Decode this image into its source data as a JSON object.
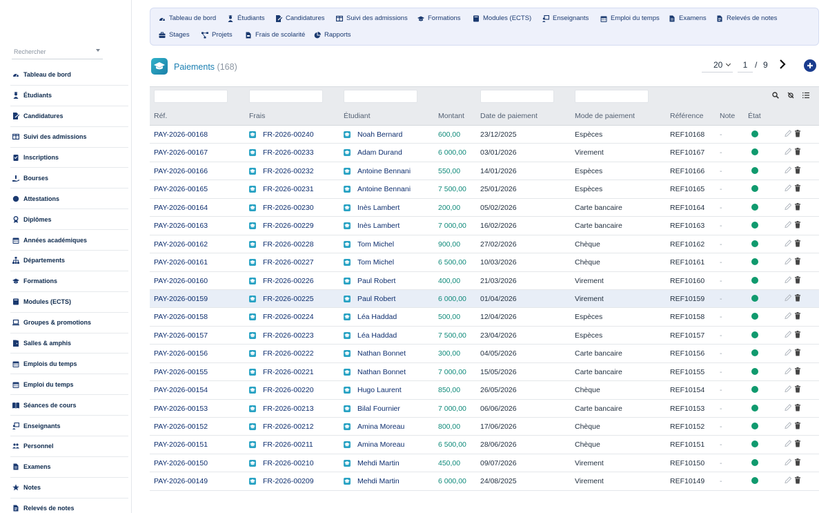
{
  "search": {
    "placeholder": "Rechercher"
  },
  "sidebar": {
    "items": [
      {
        "label": "Tableau de bord",
        "icon": "gauge-icon"
      },
      {
        "label": "Étudiants",
        "icon": "user-graduate-icon"
      },
      {
        "label": "Candidatures",
        "icon": "file-signature-icon"
      },
      {
        "label": "Suivi des admissions",
        "icon": "columns-icon"
      },
      {
        "label": "Inscriptions",
        "icon": "clipboard-icon"
      },
      {
        "label": "Bourses",
        "icon": "hand-holding-icon"
      },
      {
        "label": "Attestations",
        "icon": "certificate-icon"
      },
      {
        "label": "Diplômes",
        "icon": "award-icon"
      },
      {
        "label": "Années académiques",
        "icon": "calendar-icon"
      },
      {
        "label": "Départements",
        "icon": "sitemap-icon"
      },
      {
        "label": "Formations",
        "icon": "graduation-cap-icon"
      },
      {
        "label": "Modules (ECTS)",
        "icon": "book-icon"
      },
      {
        "label": "Groupes & promotions",
        "icon": "laptop-icon"
      },
      {
        "label": "Salles & amphis",
        "icon": "door-icon"
      },
      {
        "label": "Emplois du temps",
        "icon": "calendar-icon"
      },
      {
        "label": "Emploi du temps",
        "icon": "calendar-icon"
      },
      {
        "label": "Séances de cours",
        "icon": "book-open-icon"
      },
      {
        "label": "Enseignants",
        "icon": "chalkboard-teacher-icon"
      },
      {
        "label": "Personnel",
        "icon": "users-icon"
      },
      {
        "label": "Examens",
        "icon": "file-icon"
      },
      {
        "label": "Notes",
        "icon": "star-icon"
      },
      {
        "label": "Relevés de notes",
        "icon": "file-alt-icon"
      }
    ]
  },
  "topnav": {
    "row1": [
      {
        "label": "Tableau de bord",
        "icon": "gauge-icon"
      },
      {
        "label": "Étudiants",
        "icon": "user-graduate-icon"
      },
      {
        "label": "Candidatures",
        "icon": "file-signature-icon"
      },
      {
        "label": "Suivi des admissions",
        "icon": "columns-icon"
      },
      {
        "label": "Formations",
        "icon": "graduation-cap-icon"
      },
      {
        "label": "Modules (ECTS)",
        "icon": "book-icon"
      },
      {
        "label": "Enseignants",
        "icon": "chalkboard-teacher-icon"
      },
      {
        "label": "Emploi du temps",
        "icon": "calendar-icon"
      },
      {
        "label": "Examens",
        "icon": "file-icon"
      },
      {
        "label": "Relevés de notes",
        "icon": "file-alt-icon"
      }
    ],
    "row2": [
      {
        "label": "Stages",
        "icon": "briefcase-icon"
      },
      {
        "label": "Projets",
        "icon": "project-diagram-icon"
      },
      {
        "label": "Frais de scolarité",
        "icon": "file-invoice-icon"
      },
      {
        "label": "Rapports",
        "icon": "chart-pie-icon"
      }
    ]
  },
  "header": {
    "title": "Paiements",
    "count": "(168)",
    "per_page": "20",
    "page": "1",
    "page_sep": "/",
    "total_pages": "9"
  },
  "table": {
    "columns": [
      "Réf.",
      "Frais",
      "Étudiant",
      "Montant",
      "Date de paiement",
      "Mode de paiement",
      "Référence",
      "Note",
      "État"
    ],
    "rows": [
      {
        "ref": "PAY-2026-00168",
        "frais": "FR-2026-00240",
        "etudiant": "Noah Bernard",
        "montant": "600,00",
        "date": "23/12/2025",
        "mode": "Espèces",
        "reference": "REF10168",
        "note": "-"
      },
      {
        "ref": "PAY-2026-00167",
        "frais": "FR-2026-00233",
        "etudiant": "Adam Durand",
        "montant": "6 000,00",
        "date": "03/01/2026",
        "mode": "Virement",
        "reference": "REF10167",
        "note": "-"
      },
      {
        "ref": "PAY-2026-00166",
        "frais": "FR-2026-00232",
        "etudiant": "Antoine Bennani",
        "montant": "550,00",
        "date": "14/01/2026",
        "mode": "Espèces",
        "reference": "REF10166",
        "note": "-"
      },
      {
        "ref": "PAY-2026-00165",
        "frais": "FR-2026-00231",
        "etudiant": "Antoine Bennani",
        "montant": "7 500,00",
        "date": "25/01/2026",
        "mode": "Espèces",
        "reference": "REF10165",
        "note": "-"
      },
      {
        "ref": "PAY-2026-00164",
        "frais": "FR-2026-00230",
        "etudiant": "Inès Lambert",
        "montant": "200,00",
        "date": "05/02/2026",
        "mode": "Carte bancaire",
        "reference": "REF10164",
        "note": "-"
      },
      {
        "ref": "PAY-2026-00163",
        "frais": "FR-2026-00229",
        "etudiant": "Inès Lambert",
        "montant": "7 000,00",
        "date": "16/02/2026",
        "mode": "Carte bancaire",
        "reference": "REF10163",
        "note": "-"
      },
      {
        "ref": "PAY-2026-00162",
        "frais": "FR-2026-00228",
        "etudiant": "Tom Michel",
        "montant": "900,00",
        "date": "27/02/2026",
        "mode": "Chèque",
        "reference": "REF10162",
        "note": "-"
      },
      {
        "ref": "PAY-2026-00161",
        "frais": "FR-2026-00227",
        "etudiant": "Tom Michel",
        "montant": "6 500,00",
        "date": "10/03/2026",
        "mode": "Chèque",
        "reference": "REF10161",
        "note": "-"
      },
      {
        "ref": "PAY-2026-00160",
        "frais": "FR-2026-00226",
        "etudiant": "Paul Robert",
        "montant": "400,00",
        "date": "21/03/2026",
        "mode": "Virement",
        "reference": "REF10160",
        "note": "-"
      },
      {
        "ref": "PAY-2026-00159",
        "frais": "FR-2026-00225",
        "etudiant": "Paul Robert",
        "montant": "6 000,00",
        "date": "01/04/2026",
        "mode": "Virement",
        "reference": "REF10159",
        "note": "-"
      },
      {
        "ref": "PAY-2026-00158",
        "frais": "FR-2026-00224",
        "etudiant": "Léa Haddad",
        "montant": "500,00",
        "date": "12/04/2026",
        "mode": "Espèces",
        "reference": "REF10158",
        "note": "-"
      },
      {
        "ref": "PAY-2026-00157",
        "frais": "FR-2026-00223",
        "etudiant": "Léa Haddad",
        "montant": "7 500,00",
        "date": "23/04/2026",
        "mode": "Espèces",
        "reference": "REF10157",
        "note": "-"
      },
      {
        "ref": "PAY-2026-00156",
        "frais": "FR-2026-00222",
        "etudiant": "Nathan Bonnet",
        "montant": "300,00",
        "date": "04/05/2026",
        "mode": "Carte bancaire",
        "reference": "REF10156",
        "note": "-"
      },
      {
        "ref": "PAY-2026-00155",
        "frais": "FR-2026-00221",
        "etudiant": "Nathan Bonnet",
        "montant": "7 000,00",
        "date": "15/05/2026",
        "mode": "Carte bancaire",
        "reference": "REF10155",
        "note": "-"
      },
      {
        "ref": "PAY-2026-00154",
        "frais": "FR-2026-00220",
        "etudiant": "Hugo Laurent",
        "montant": "850,00",
        "date": "26/05/2026",
        "mode": "Chèque",
        "reference": "REF10154",
        "note": "-"
      },
      {
        "ref": "PAY-2026-00153",
        "frais": "FR-2026-00213",
        "etudiant": "Bilal Fournier",
        "montant": "7 000,00",
        "date": "06/06/2026",
        "mode": "Carte bancaire",
        "reference": "REF10153",
        "note": "-"
      },
      {
        "ref": "PAY-2026-00152",
        "frais": "FR-2026-00212",
        "etudiant": "Amina Moreau",
        "montant": "800,00",
        "date": "17/06/2026",
        "mode": "Chèque",
        "reference": "REF10152",
        "note": "-"
      },
      {
        "ref": "PAY-2026-00151",
        "frais": "FR-2026-00211",
        "etudiant": "Amina Moreau",
        "montant": "6 500,00",
        "date": "28/06/2026",
        "mode": "Chèque",
        "reference": "REF10151",
        "note": "-"
      },
      {
        "ref": "PAY-2026-00150",
        "frais": "FR-2026-00210",
        "etudiant": "Mehdi Martin",
        "montant": "450,00",
        "date": "09/07/2026",
        "mode": "Virement",
        "reference": "REF10150",
        "note": "-"
      },
      {
        "ref": "PAY-2026-00149",
        "frais": "FR-2026-00209",
        "etudiant": "Mehdi Martin",
        "montant": "6 000,00",
        "date": "24/08/2025",
        "mode": "Virement",
        "reference": "REF10149",
        "note": "-"
      }
    ]
  },
  "colors": {
    "accent": "#1a3c8e",
    "title": "#1b7fb2",
    "amount": "#0f8a7a",
    "status_ok": "#109a6e",
    "nav_bg": "#eef1fb"
  }
}
